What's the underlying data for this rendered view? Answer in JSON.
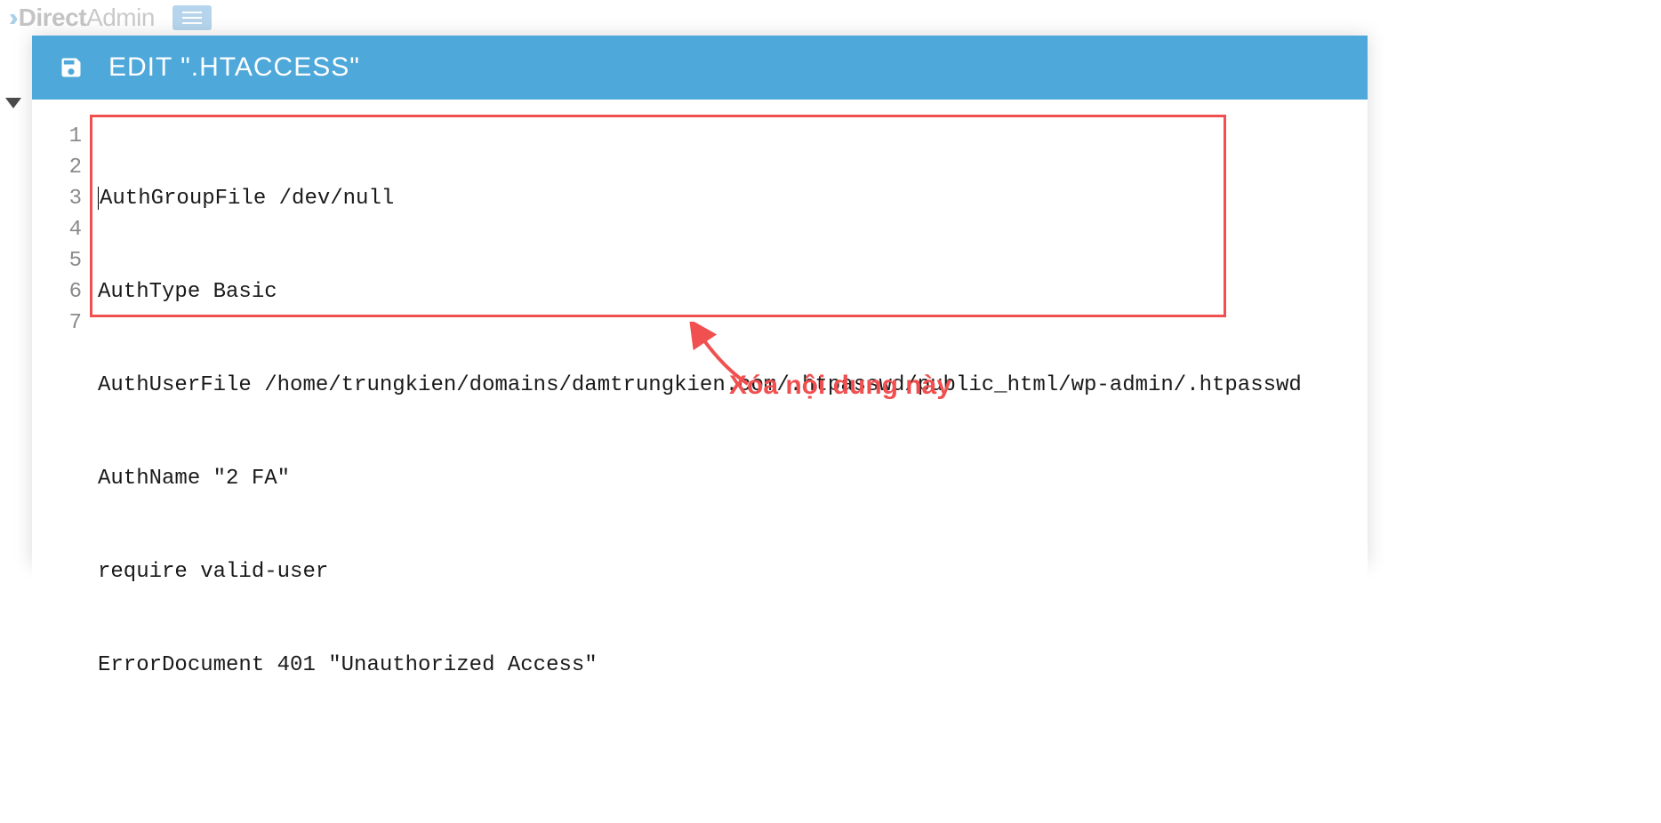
{
  "brand": {
    "direct": "Direct",
    "admin": "Admin"
  },
  "modal": {
    "title": "EDIT \".HTACCESS\""
  },
  "editor": {
    "lines": {
      "n1": "1",
      "n2": "2",
      "n3": "3",
      "n4": "4",
      "n5": "5",
      "n6": "6",
      "n7": "7",
      "l1": "AuthGroupFile /dev/null",
      "l2": "AuthType Basic",
      "l3": "AuthUserFile /home/trungkien/domains/damtrungkien.com/.htpasswd/public_html/wp-admin/.htpasswd",
      "l4": "AuthName \"2 FA\"",
      "l5": "require valid-user",
      "l6": "ErrorDocument 401 \"Unauthorized Access\"",
      "l7": ""
    }
  },
  "annotation": {
    "text": "Xóa nội dung này"
  }
}
